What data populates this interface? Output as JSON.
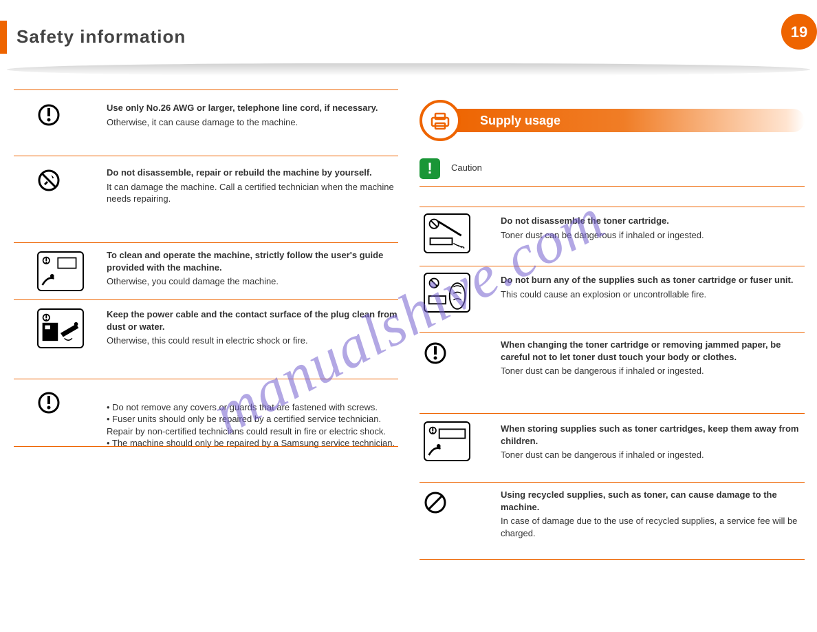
{
  "header": {
    "title": "Safety information",
    "page_number": "19"
  },
  "left_rows": [
    {
      "bold": "Use only No.26 AWG or larger, telephone line cord, if necessary.",
      "body": "Otherwise, it can cause damage to the machine."
    },
    {
      "bold": "Do not disassemble, repair or rebuild the machine by yourself.",
      "body": "It can damage the machine. Call a certified technician when the machine needs repairing."
    },
    {
      "bold": "To clean and operate the machine, strictly follow the user's guide provided with the machine.",
      "body": "Otherwise, you could damage the machine."
    },
    {
      "bold": "Keep the power cable and the contact surface of the plug clean from dust or water.",
      "body": "Otherwise, this could result in electric shock or fire."
    },
    {
      "bold": "",
      "body": "• Do not remove any covers or guards that are fastened with screws.\n• Fuser units should only be repaired by a certified service technician. Repair by non-certified technicians could result in fire or electric shock.\n• The machine should only be repaired by a Samsung service technician."
    }
  ],
  "section_right": {
    "title": "Supply usage",
    "note": "Caution"
  },
  "right_rows": [
    {
      "bold": "Do not disassemble the toner cartridge.",
      "body": "Toner dust can be dangerous if inhaled or ingested."
    },
    {
      "bold": "Do not burn any of the supplies such as toner cartridge or fuser unit.",
      "body": "This could cause an explosion or uncontrollable fire."
    },
    {
      "bold": "When changing the toner cartridge or removing jammed paper, be careful not to let toner dust touch your body or clothes.",
      "body": "Toner dust can be dangerous if inhaled or ingested."
    },
    {
      "bold": "When storing supplies such as toner cartridges, keep them away from children.",
      "body": "Toner dust can be dangerous if inhaled or ingested."
    },
    {
      "bold": "Using recycled supplies, such as toner, can cause damage to the machine.",
      "body": "In case of damage due to the use of recycled supplies, a service fee will be charged."
    }
  ],
  "watermark": "manualshive.com",
  "icons": {
    "warn": "warning-exclamation",
    "no_repair": "no-repair",
    "keep_away": "keep-away-children",
    "clean_plug": "clean-plug",
    "no_disassemble": "no-disassemble-toner",
    "no_burn": "no-burn",
    "store": "store-supplies",
    "prohibit": "prohibit"
  }
}
